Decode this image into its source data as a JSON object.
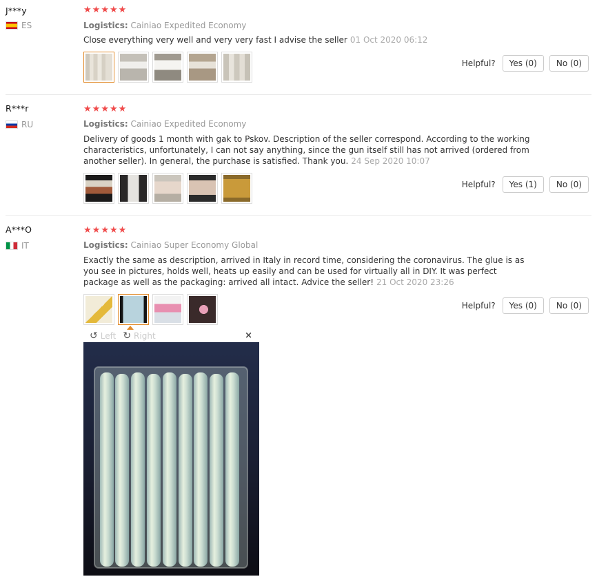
{
  "reviews": [
    {
      "user": "J***y",
      "country": "ES",
      "logistics_label": "Logistics:",
      "logistics_value": "Cainiao Expedited Economy",
      "text": "Close everything very well and very very fast I advise the seller",
      "date": "01 Oct 2020 06:12",
      "helpful_label": "Helpful?",
      "yes_label": "Yes (0)",
      "no_label": "No (0)",
      "photo_count": 5
    },
    {
      "user": "R***r",
      "country": "RU",
      "logistics_label": "Logistics:",
      "logistics_value": "Cainiao Expedited Economy",
      "text": "Delivery of goods 1 month with gak to Pskov. Description of the seller correspond. According to the working characteristics, unfortunately, I can not say anything, since the gun itself still has not arrived (ordered from another seller). In general, the purchase is satisfied. Thank you.",
      "date": "24 Sep 2020 10:07",
      "helpful_label": "Helpful?",
      "yes_label": "Yes (1)",
      "no_label": "No (0)",
      "photo_count": 5
    },
    {
      "user": "A***O",
      "country": "IT",
      "logistics_label": "Logistics:",
      "logistics_value": "Cainiao Super Economy Global",
      "text": "Exactly the same as description, arrived in Italy in record time, considering the coronavirus. The glue is as you see in pictures, holds well, heats up easily and can be used for virtually all in DIY. It was perfect package as well as the packaging: arrived all intact. Advice the seller!",
      "date": "21 Oct 2020 23:26",
      "helpful_label": "Helpful?",
      "yes_label": "Yes (0)",
      "no_label": "No (0)",
      "photo_count": 4
    }
  ],
  "rating_stars": 5,
  "viewer": {
    "left_label": "Left",
    "right_label": "Right",
    "close_symbol": "×"
  },
  "icons": {
    "star": "star-icon",
    "rotate_left": "rotate-left-icon",
    "rotate_right": "rotate-right-icon",
    "close": "close-icon"
  },
  "colors": {
    "star": "#f04b4b",
    "selected_border": "#e28c2c",
    "muted_text": "#999999"
  }
}
